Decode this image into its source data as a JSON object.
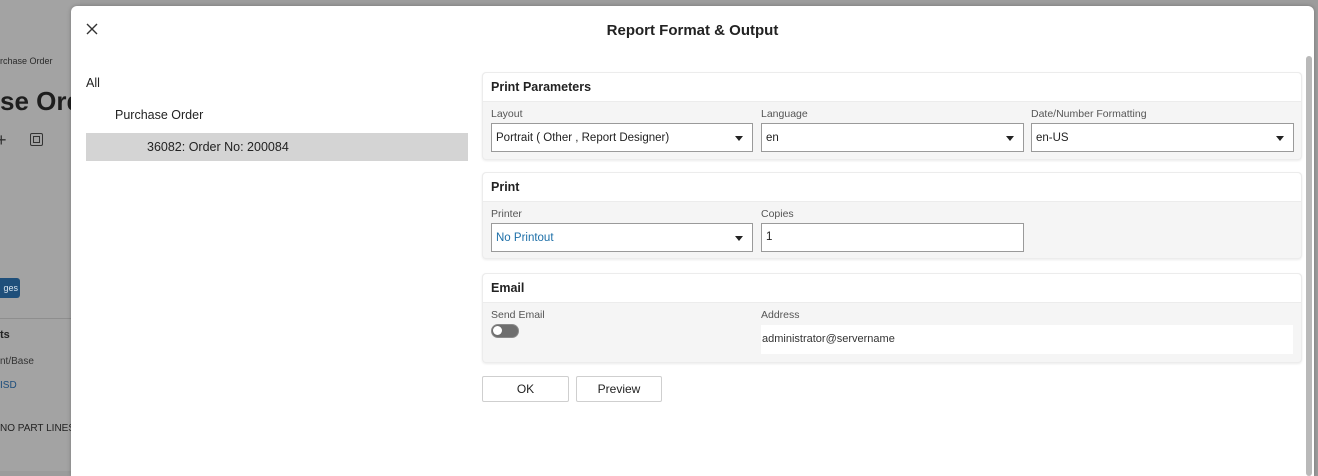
{
  "background": {
    "breadcrumb": "rchase Order",
    "page_title": "se Ord",
    "badge_text": "ges",
    "section_title": "ts",
    "section_sub": "nt/Base",
    "currency": "ISD",
    "no_parts": "NO PART LINES"
  },
  "dialog": {
    "title": "Report Format & Output",
    "close_icon": "close-icon"
  },
  "tree": {
    "root": "All",
    "group": "Purchase Order",
    "selected_item": "36082: Order No: 200084"
  },
  "print_parameters": {
    "title": "Print Parameters",
    "layout_label": "Layout",
    "layout_value": "Portrait ( Other , Report Designer)",
    "language_label": "Language",
    "language_value": "en",
    "format_label": "Date/Number Formatting",
    "format_value": "en-US"
  },
  "print": {
    "title": "Print",
    "printer_label": "Printer",
    "printer_value": "No Printout",
    "copies_label": "Copies",
    "copies_value": "1"
  },
  "email": {
    "title": "Email",
    "send_label": "Send Email",
    "send_enabled": false,
    "address_label": "Address",
    "address_value": "administrator@servername"
  },
  "actions": {
    "ok_label": "OK",
    "preview_label": "Preview"
  },
  "colors": {
    "link": "#1d6fa8",
    "selected_row": "#d4d4d4",
    "overlay": "#9c9c9c"
  }
}
